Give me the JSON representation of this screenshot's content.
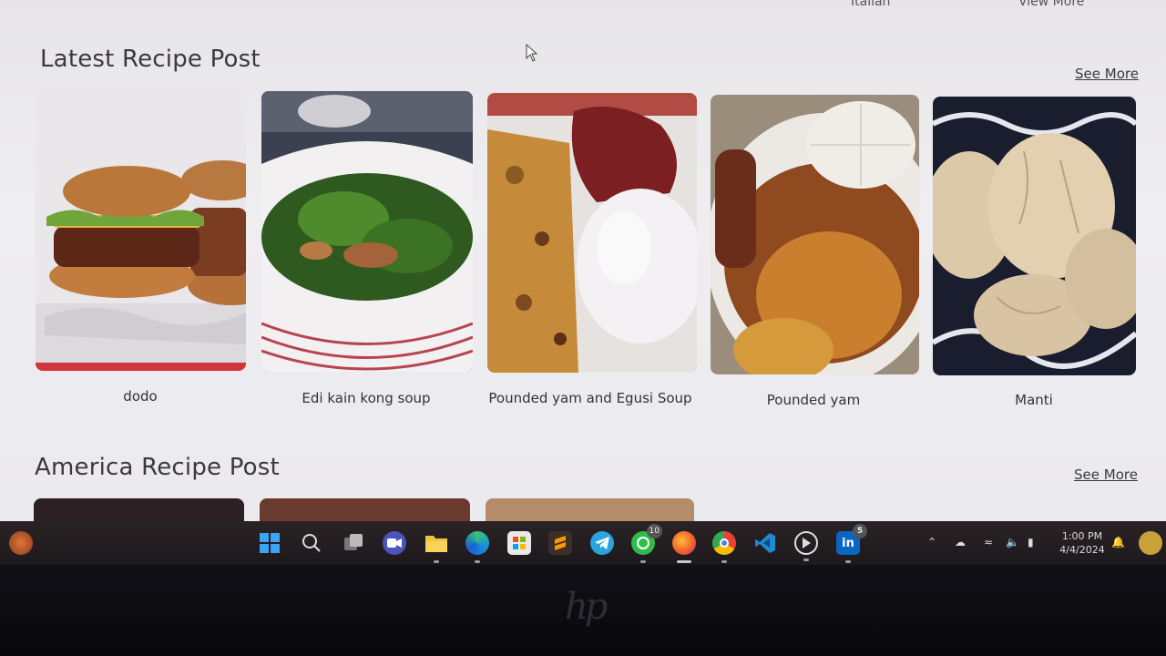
{
  "header": {
    "top_links": [
      "Italian",
      "View More"
    ]
  },
  "sections": [
    {
      "title": "Latest Recipe Post",
      "see_more": "See More",
      "recipes": [
        {
          "name": "dodo"
        },
        {
          "name": "Edi kain kong soup"
        },
        {
          "name": "Pounded yam and Egusi Soup"
        },
        {
          "name": "Pounded yam"
        },
        {
          "name": "Manti"
        }
      ]
    },
    {
      "title": "America Recipe Post",
      "see_more": "See More"
    }
  ],
  "taskbar": {
    "apps": [
      {
        "icon": "windows-start-icon"
      },
      {
        "icon": "search-icon"
      },
      {
        "icon": "task-view-icon"
      },
      {
        "icon": "meet-icon"
      },
      {
        "icon": "file-explorer-icon"
      },
      {
        "icon": "edge-icon"
      },
      {
        "icon": "store-icon"
      },
      {
        "icon": "sublime-text-icon"
      },
      {
        "icon": "telegram-icon"
      },
      {
        "icon": "whatsapp-icon",
        "badge": "10"
      },
      {
        "icon": "firefox-icon"
      },
      {
        "icon": "chrome-icon"
      },
      {
        "icon": "vscode-icon"
      },
      {
        "icon": "media-player-icon"
      },
      {
        "icon": "linkedin-icon",
        "badge": "5"
      }
    ],
    "clock": {
      "time": "1:00 PM",
      "date": "4/4/2024"
    }
  }
}
